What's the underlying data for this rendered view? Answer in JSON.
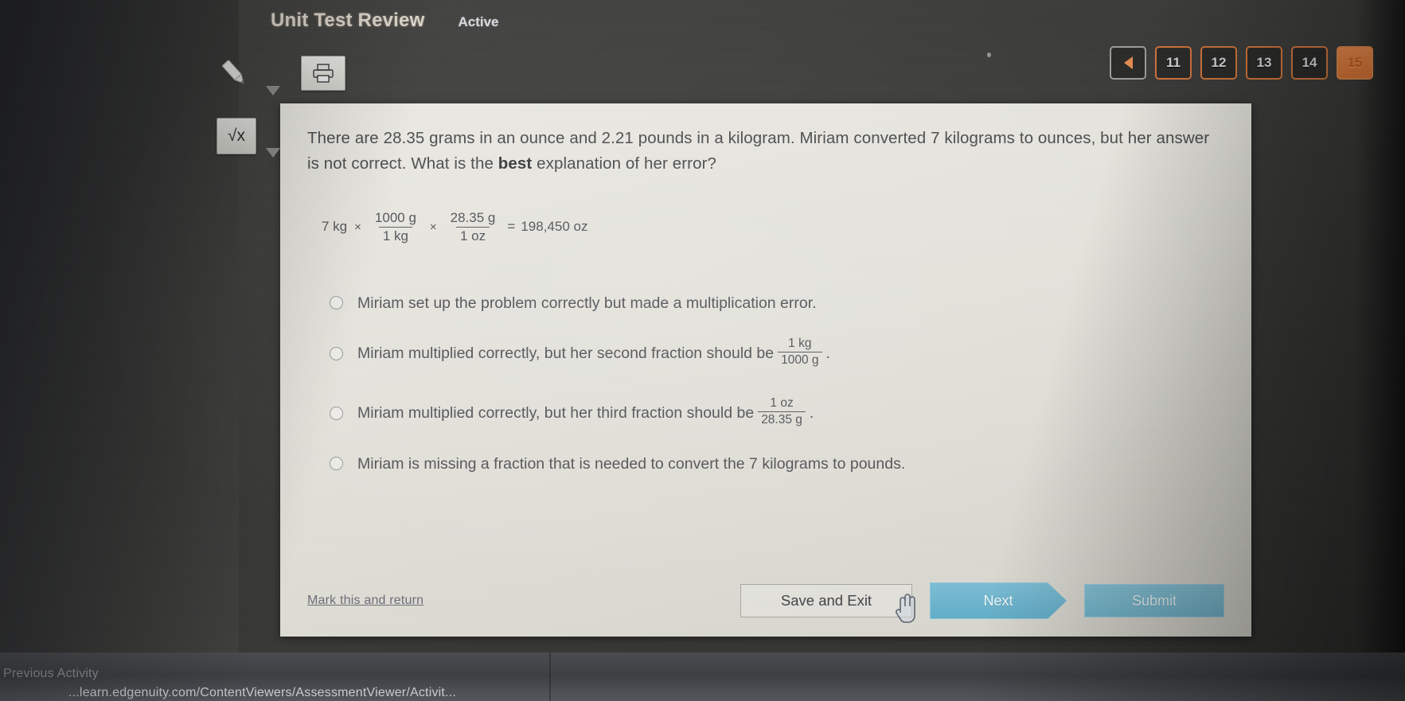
{
  "header": {
    "title": "Unit Test Review",
    "status": "Active"
  },
  "toolbar": {
    "pencil_icon": "pencil-icon",
    "print_icon": "printer-icon",
    "sqrt_icon": "√x"
  },
  "pagination": {
    "prev_label": "",
    "pages": [
      {
        "label": "11",
        "active": false
      },
      {
        "label": "12",
        "active": false
      },
      {
        "label": "13",
        "active": false
      },
      {
        "label": "14",
        "active": false
      },
      {
        "label": "15",
        "active": true
      }
    ],
    "accent_color": "#d2763c",
    "active_fill": "#e2803f"
  },
  "question": {
    "line1": "There are 28.35 grams in an ounce and 2.21 pounds in a kilogram. Miriam converted 7 kilograms to ounces, but her",
    "line2_pre": "answer is not correct. What is the ",
    "line2_bold": "best",
    "line2_post": " explanation of her error?",
    "equation": {
      "lead": "7 kg",
      "times1": "×",
      "frac1_num": "1000 g",
      "frac1_den": "1 kg",
      "times2": "×",
      "frac2_num": "28.35 g",
      "frac2_den": "1 oz",
      "equals": "=",
      "result": "198,450 oz"
    }
  },
  "options": [
    {
      "text": "Miriam set up the problem correctly but made a multiplication error.",
      "has_fraction": false,
      "frac_num": "",
      "frac_den": "",
      "suffix": "",
      "selected": false
    },
    {
      "text": "Miriam multiplied correctly, but her second fraction should be",
      "has_fraction": true,
      "frac_num": "1 kg",
      "frac_den": "1000 g",
      "suffix": ".",
      "selected": false
    },
    {
      "text": "Miriam multiplied correctly, but her third fraction should be",
      "has_fraction": true,
      "frac_num": "1 oz",
      "frac_den": "28.35 g",
      "suffix": ".",
      "selected": false
    },
    {
      "text": "Miriam is missing a fraction that is needed to convert the 7 kilograms to pounds.",
      "has_fraction": false,
      "frac_num": "",
      "frac_den": "",
      "suffix": "",
      "selected": false
    }
  ],
  "actions": {
    "mark_link": "Mark this and return",
    "save_and_exit": "Save and Exit",
    "next": "Next",
    "submit": "Submit",
    "next_color": "#6fb4cc",
    "submit_color": "#7bbcd2"
  },
  "statusbar": {
    "previous_activity": "Previous Activity",
    "url": "...learn.edgenuity.com/ContentViewers/AssessmentViewer/Activit..."
  }
}
